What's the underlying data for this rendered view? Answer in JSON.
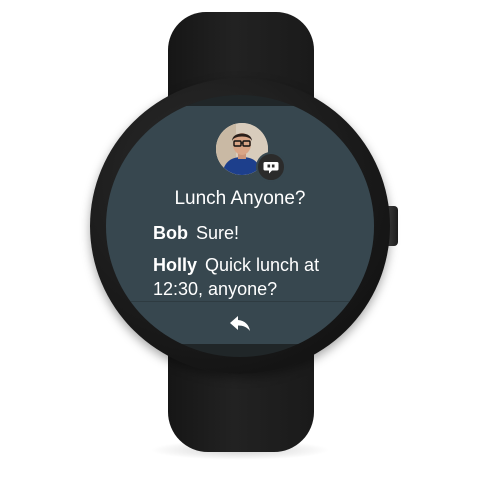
{
  "notification": {
    "title": "Lunch Anyone?",
    "messages": [
      {
        "sender": "Bob",
        "text": "Sure!"
      },
      {
        "sender": "Holly",
        "text": "Quick lunch at 12:30, anyone?"
      }
    ]
  },
  "icons": {
    "avatar": "contact-photo",
    "app_badge": "chat-bubble-icon",
    "action": "reply-icon"
  },
  "colors": {
    "card_background": "#37474f",
    "text": "#ffffff",
    "watch_body": "#1c1c1c"
  }
}
